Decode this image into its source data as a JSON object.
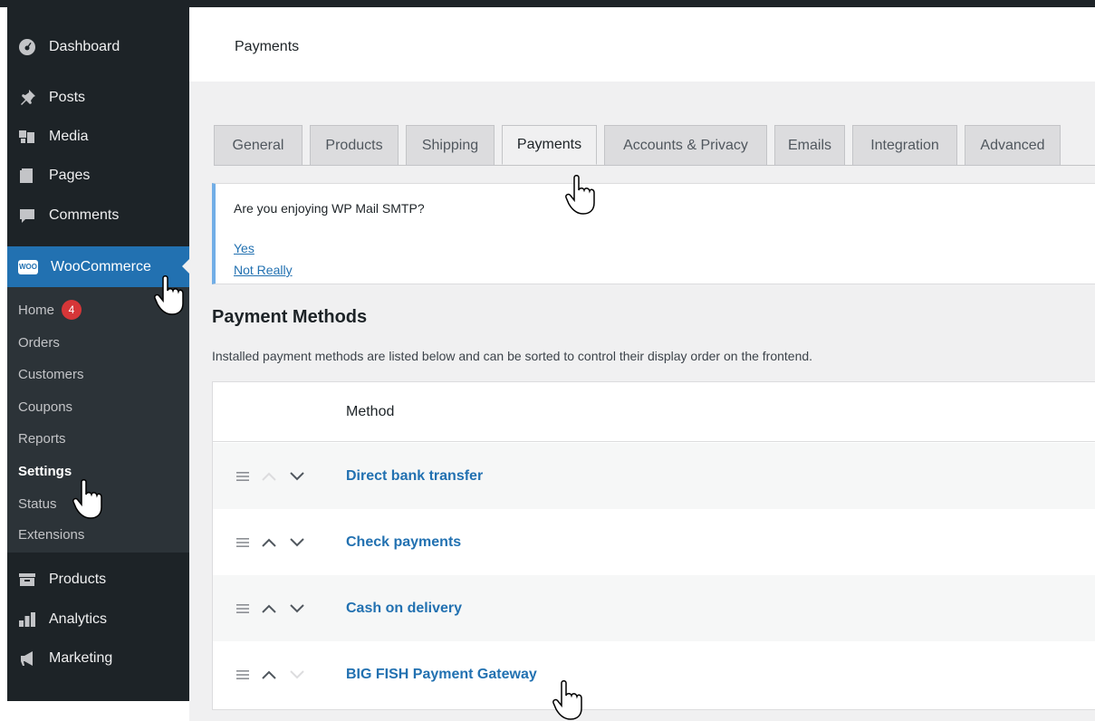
{
  "sidebar": {
    "top_items": [
      {
        "label": "Dashboard",
        "icon": "dashboard-icon"
      },
      {
        "label": "Posts",
        "icon": "pin-icon"
      },
      {
        "label": "Media",
        "icon": "media-icon"
      },
      {
        "label": "Pages",
        "icon": "pages-icon"
      },
      {
        "label": "Comments",
        "icon": "comments-icon"
      }
    ],
    "woocommerce": {
      "label": "WooCommerce",
      "logo_text": "WOO"
    },
    "submenu": [
      {
        "label": "Home",
        "badge": "4"
      },
      {
        "label": "Orders"
      },
      {
        "label": "Customers"
      },
      {
        "label": "Coupons"
      },
      {
        "label": "Reports"
      },
      {
        "label": "Settings",
        "current": true
      },
      {
        "label": "Status"
      },
      {
        "label": "Extensions"
      }
    ],
    "bottom_items": [
      {
        "label": "Products",
        "icon": "products-icon"
      },
      {
        "label": "Analytics",
        "icon": "analytics-icon"
      },
      {
        "label": "Marketing",
        "icon": "megaphone-icon"
      }
    ]
  },
  "header": {
    "title": "Payments"
  },
  "tabs": [
    {
      "label": "General"
    },
    {
      "label": "Products"
    },
    {
      "label": "Shipping"
    },
    {
      "label": "Payments",
      "active": true
    },
    {
      "label": "Accounts & Privacy"
    },
    {
      "label": "Emails"
    },
    {
      "label": "Integration"
    },
    {
      "label": "Advanced"
    }
  ],
  "notice": {
    "text": "Are you enjoying WP Mail SMTP?",
    "yes_label": "Yes",
    "no_label": "Not Really"
  },
  "payment_methods": {
    "title": "Payment Methods",
    "description": "Installed payment methods are listed below and can be sorted to control their display order on the frontend.",
    "column_method": "Method",
    "rows": [
      {
        "name": "Direct bank transfer",
        "up_enabled": false,
        "down_enabled": true
      },
      {
        "name": "Check payments",
        "up_enabled": true,
        "down_enabled": true
      },
      {
        "name": "Cash on delivery",
        "up_enabled": true,
        "down_enabled": true
      },
      {
        "name": "BIG FISH Payment Gateway",
        "up_enabled": true,
        "down_enabled": false
      }
    ]
  },
  "colors": {
    "sidebar_bg": "#1d2327",
    "accent": "#2271b1",
    "badge": "#d63638",
    "notice_border": "#72aee6"
  }
}
